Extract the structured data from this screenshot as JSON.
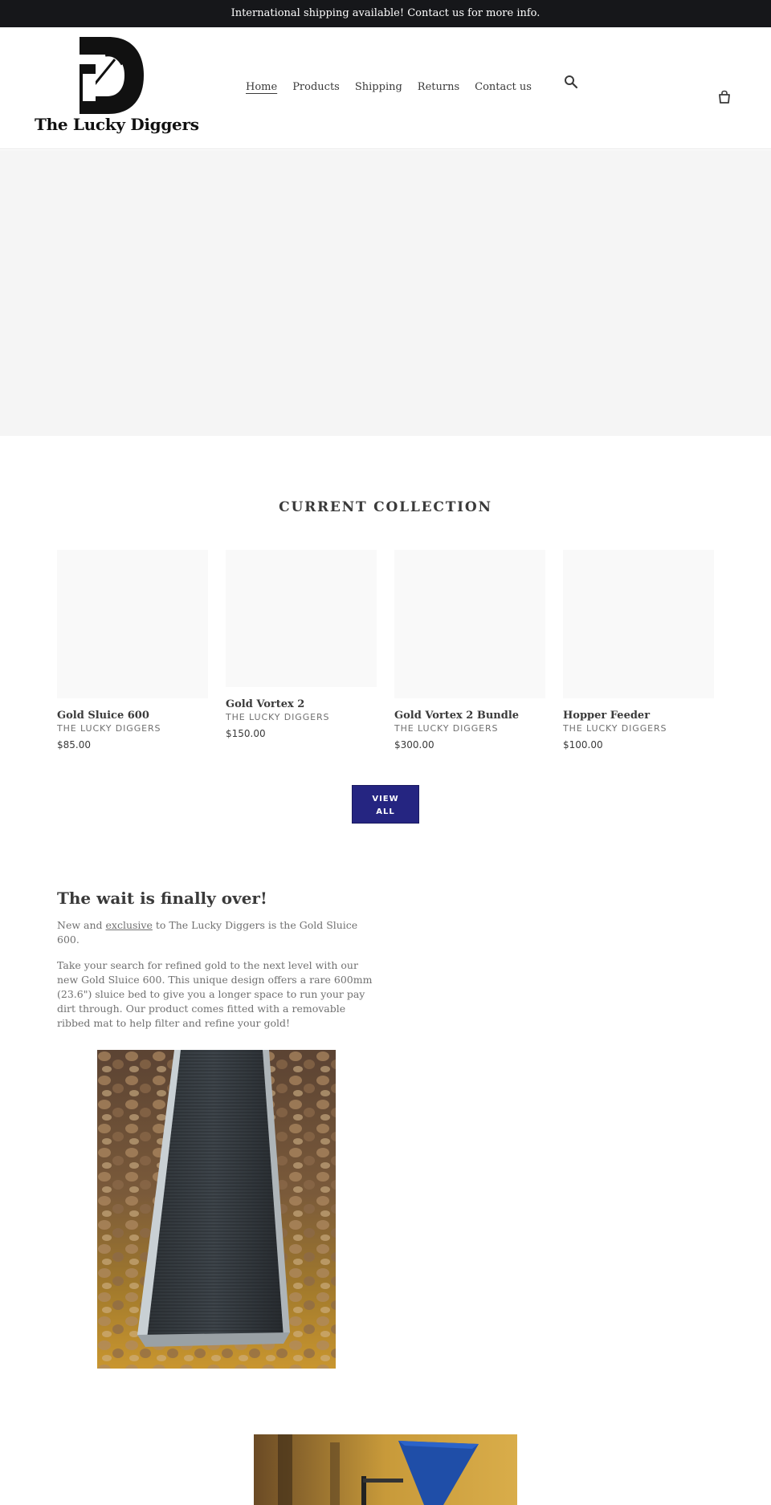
{
  "announcement": {
    "text": "International shipping available! Contact us for more info."
  },
  "header": {
    "logo_text": "The Lucky Diggers",
    "nav": [
      "Home",
      "Products",
      "Shipping",
      "Returns",
      "Contact us"
    ],
    "active_nav": "Home",
    "search_icon": "search-icon",
    "cart_icon": "cart-icon"
  },
  "collection": {
    "title": "CURRENT COLLECTION",
    "products": [
      {
        "title": "Gold Sluice 600",
        "vendor": "THE LUCKY DIGGERS",
        "price": "$85.00"
      },
      {
        "title": "Gold Vortex 2",
        "vendor": "THE LUCKY DIGGERS",
        "price": "$150.00"
      },
      {
        "title": "Gold Vortex 2 Bundle",
        "vendor": "THE LUCKY DIGGERS",
        "price": "$300.00"
      },
      {
        "title": "Hopper Feeder",
        "vendor": "THE LUCKY DIGGERS",
        "price": "$100.00"
      }
    ],
    "view_all_line1": "VIEW",
    "view_all_line2": "ALL"
  },
  "feature": {
    "heading": "The wait is finally over!",
    "p1_before": "New and ",
    "p1_link": "exclusive",
    "p1_after": " to The Lucky Diggers is the Gold Sluice 600.",
    "p2": "Take your search for refined gold to the next level with our new Gold Sluice 600. This unique design offers a rare 600mm (23.6\") sluice bed to give you a longer space to run your pay dirt through. Our product comes fitted with a removable ribbed mat to help filter and refine your gold!"
  },
  "colors": {
    "announcement_bg": "#16171a",
    "button_bg": "#252581",
    "hero_bg": "#f5f5f5",
    "text": "#3a3a3a",
    "muted": "#707070"
  }
}
